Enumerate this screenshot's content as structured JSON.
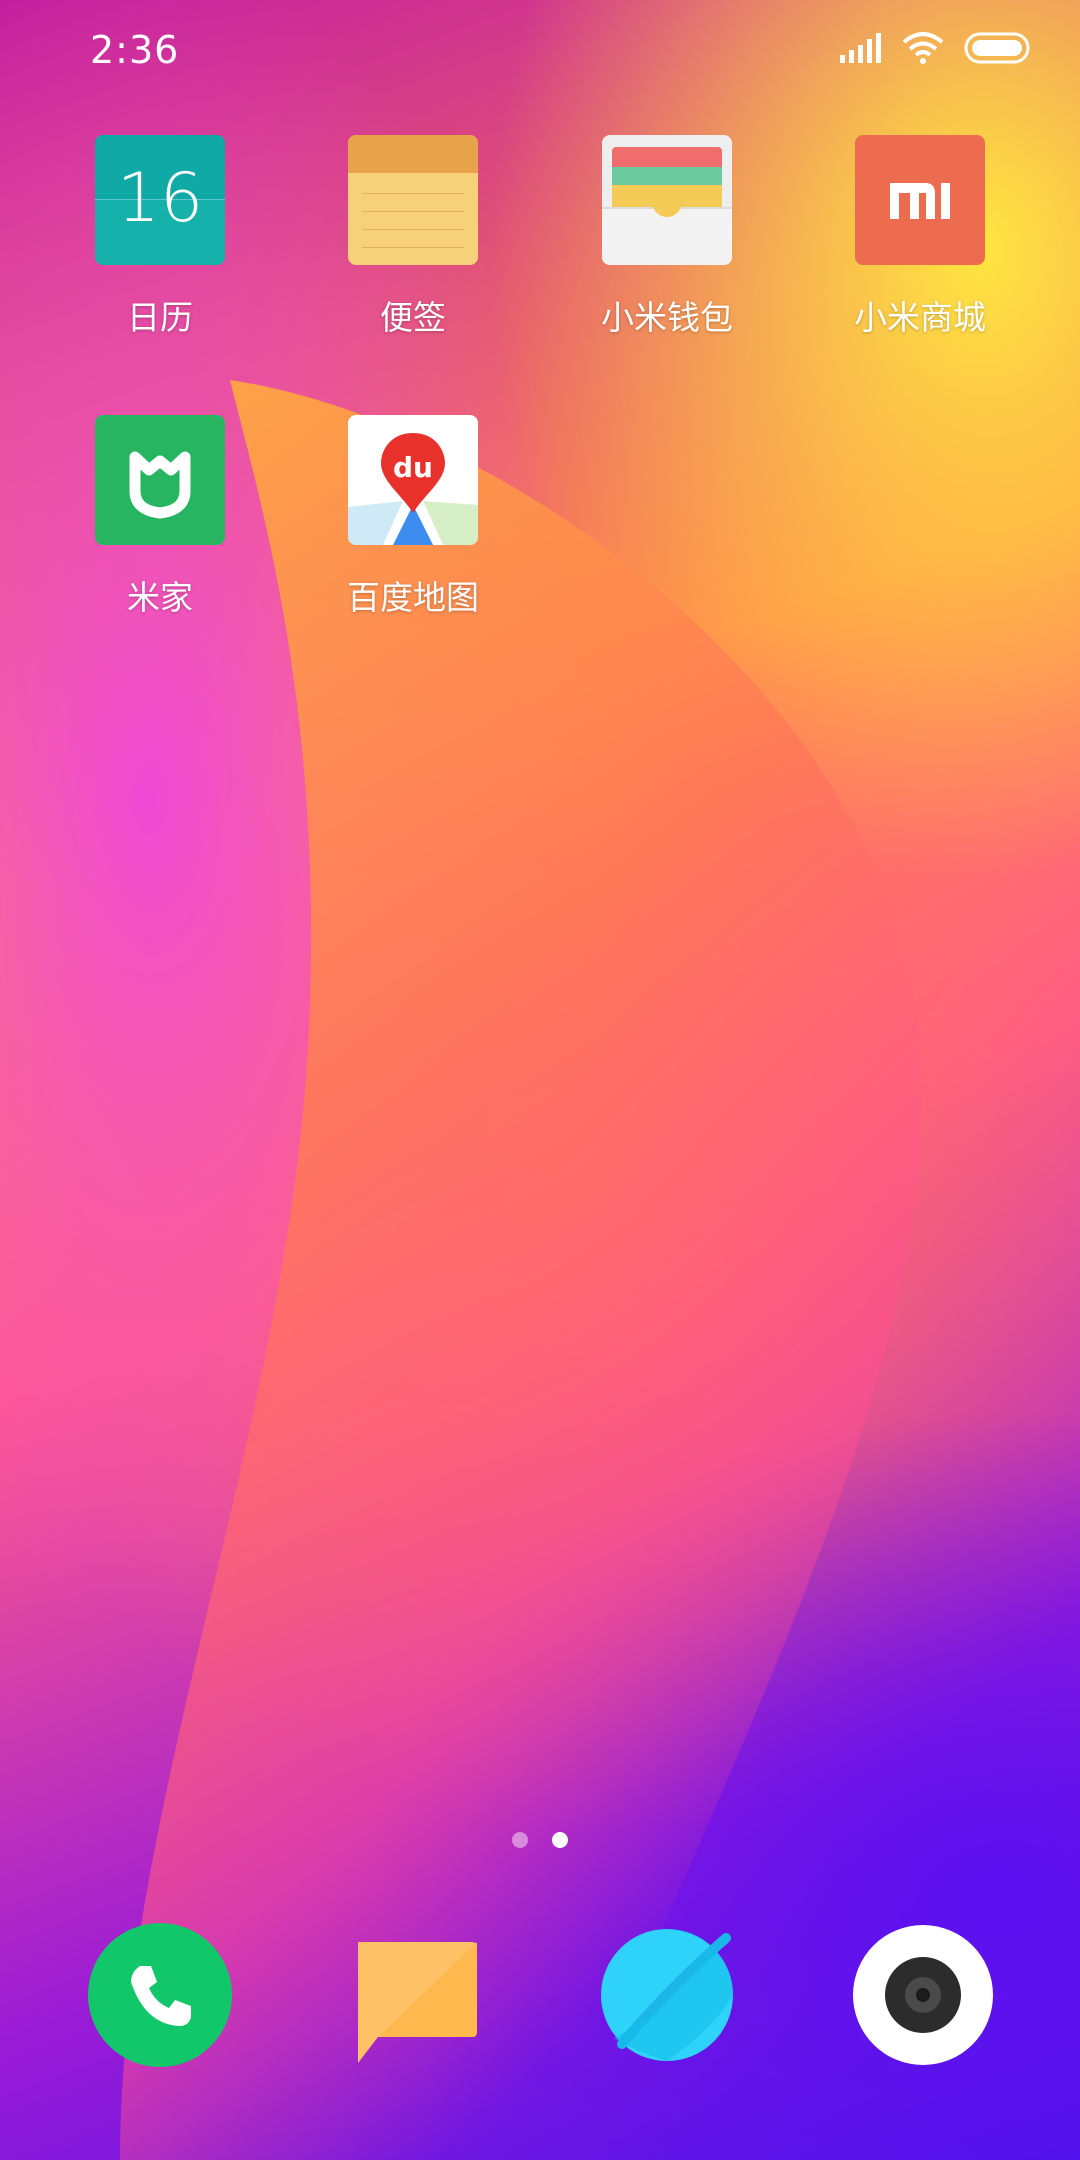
{
  "status_bar": {
    "time": "2:36",
    "icons": [
      "signal-icon",
      "wifi-icon",
      "battery-icon"
    ]
  },
  "apps": [
    {
      "label": "日历",
      "icon": "calendar-icon",
      "day": "16"
    },
    {
      "label": "便签",
      "icon": "notes-icon"
    },
    {
      "label": "小米钱包",
      "icon": "wallet-icon"
    },
    {
      "label": "小米商城",
      "icon": "mi-store-icon",
      "logo": "mi"
    },
    {
      "label": "米家",
      "icon": "mijia-icon"
    },
    {
      "label": "百度地图",
      "icon": "baidu-maps-icon",
      "logo": "du"
    }
  ],
  "page_indicator": {
    "count": 2,
    "active": 2
  },
  "dock": [
    {
      "icon": "phone-icon",
      "color": "#12c76a"
    },
    {
      "icon": "messages-icon",
      "color": "#ffc166"
    },
    {
      "icon": "browser-icon",
      "color": "#1fc8f2"
    },
    {
      "icon": "camera-icon",
      "color": "#ffffff"
    }
  ],
  "colors": {
    "calendar": "#17b1ac",
    "notes": "#f7d17a",
    "mi_store": "#ed6c4f",
    "mijia": "#28b562",
    "baidu_red": "#e9312b"
  }
}
